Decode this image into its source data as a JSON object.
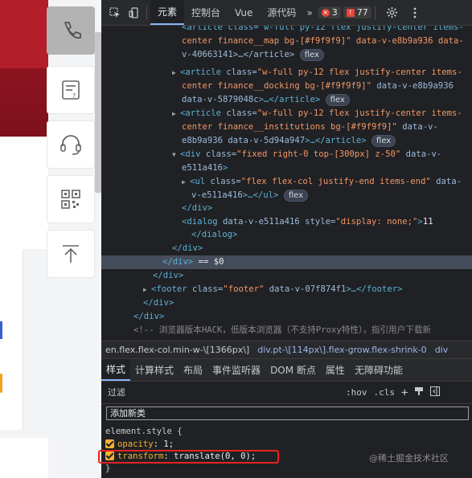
{
  "devtools": {
    "tabs": [
      "元素",
      "控制台",
      "Vue",
      "源代码"
    ],
    "more_tabs": "»",
    "errors_count": "3",
    "warnings_count": "77"
  },
  "dom_tree": {
    "l1": {
      "a": "<article class=\"w-full py-12 flex justify-center items-",
      "b": ""
    },
    "l2": {
      "a": "center finance__map bg-[#f9f9f9]\" data-v-e8b9a936 data-"
    },
    "l3": {
      "a": "v-40663141>…</article>",
      "pill": "flex"
    },
    "l4": {
      "tag": "<article",
      "attr": " class=",
      "val": "\"w-full py-12 flex justify-center items-"
    },
    "l5": {
      "val": "center finance__docking bg-[#f9f9f9]\"",
      "attr": " data-v-e8b9a936"
    },
    "l6": {
      "attr": "data-v-5879048c",
      "tag": ">…</article>",
      "pill": "flex"
    },
    "l7": {
      "tag": "<article",
      "attr": " class=",
      "val": "\"w-full py-12 flex justify-center items-"
    },
    "l8": {
      "val": "center finance__institutions bg-[#f9f9f9]\"",
      "attr": " data-v-"
    },
    "l9": {
      "attr": "e8b9a936 data-v-5d94a947",
      "tag": ">…</article>",
      "pill": "flex"
    },
    "l10": {
      "tag": "<div",
      "attr": " class=",
      "val": "\"fixed right-0 top-[300px] z-50\"",
      "attr2": " data-v-"
    },
    "l11": {
      "attr": "e511a416",
      "tag": ">"
    },
    "l12": {
      "tag": "<ul",
      "attr": " class=",
      "val": "\"flex flex-col justify-end items-end\"",
      "attr2": " data-"
    },
    "l13": {
      "attr": "v-e511a416",
      "tag": ">…</ul>",
      "pill": "flex"
    },
    "l14": {
      "tag": "</div>"
    },
    "l15": {
      "tag": "<dialog",
      "attr": " data-v-e511a416 style=",
      "val": "\"display: none;\"",
      "tag2": ">",
      "text": "11"
    },
    "l16": {
      "tag": "</dialog>"
    },
    "l17": {
      "tag": "</div>"
    },
    "l18": {
      "tag": "</div>",
      "text": " == $0"
    },
    "l19": {
      "tag": "</div>"
    },
    "l20": {
      "tag": "<footer",
      "attr": " class=",
      "val": "\"footer\"",
      "attr2": " data-v-07f874f1",
      "tag2": ">…</footer>"
    },
    "l21": {
      "tag": "</div>"
    },
    "l22": {
      "tag": "</div>"
    },
    "l23": {
      "comment": "<!-- 浏览器版本HACK，低版本浏览器（不支持Proxy特性），指引用户下载新"
    }
  },
  "breadcrumbs": [
    "en.flex.flex-col.min-w-\\[1366px\\]",
    "div.pt-\\[114px\\].flex-grow.flex-shrink-0",
    "div"
  ],
  "styles_tabs": [
    "样式",
    "计算样式",
    "布局",
    "事件监听器",
    "DOM 断点",
    "属性",
    "无障碍功能"
  ],
  "filter": {
    "placeholder": "过滤",
    "hov": ":hov",
    "cls": ".cls"
  },
  "new_class_placeholder": "添加新类",
  "styles": {
    "selector": "element.style {",
    "p1_name": "opacity",
    "p1_value": "1;",
    "p2_name": "transform",
    "p2_value": "translate(0, 0);",
    "close": "}"
  },
  "watermark": "@稀土掘金技术社区",
  "colors": {
    "highlight_box": "#e6231f",
    "accent": "#8ab4f8",
    "brand_red": "#b31e2a"
  }
}
